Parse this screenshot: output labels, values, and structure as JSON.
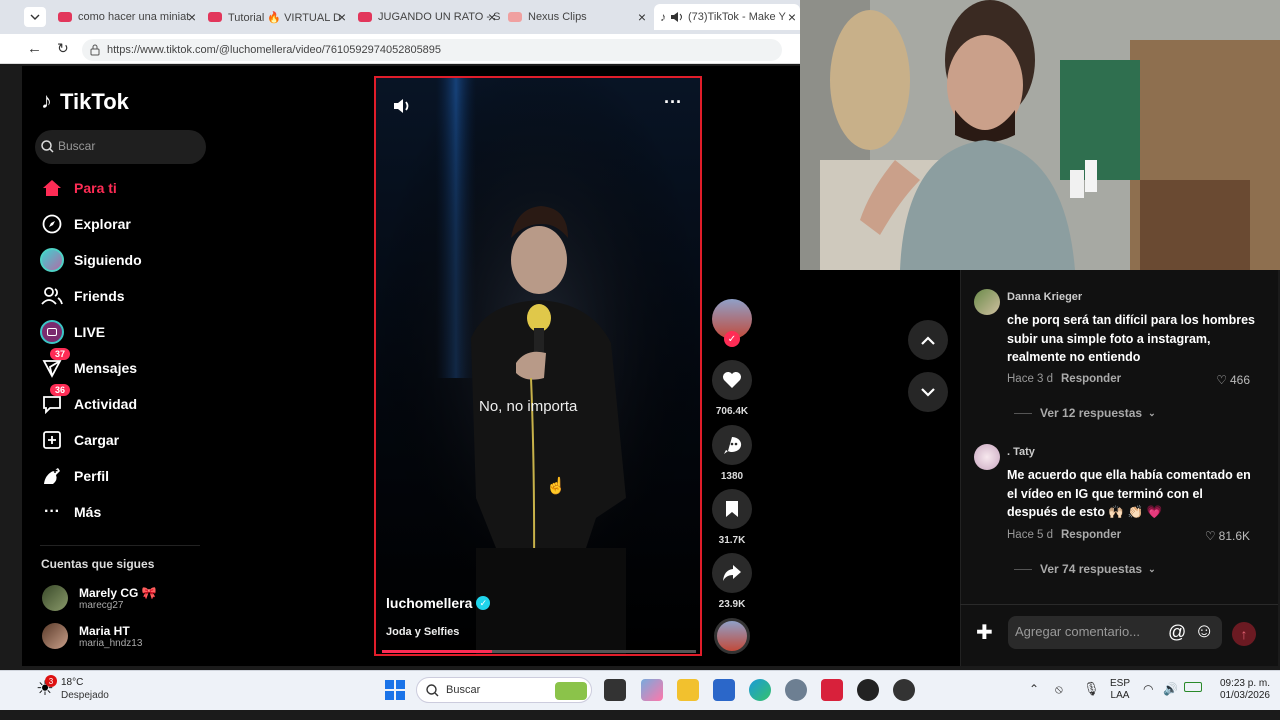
{
  "browser": {
    "tabs": [
      {
        "title": "como hacer una miniat",
        "color": "#e24a7c"
      },
      {
        "title": "Tutorial 🔥 VIRTUAL D",
        "color": "#e24a7c"
      },
      {
        "title": "JUGANDO UN RATO - S",
        "color": "#e24a7c"
      },
      {
        "title": "Nexus Clips",
        "color": "#f08a8a"
      },
      {
        "title": "(73)TikTok - Make Y",
        "color": "#000000",
        "active": true
      }
    ],
    "url": "https://www.tiktok.com/@luchomellera/video/7610592974052805895"
  },
  "tiktok": {
    "logo": "TikTok",
    "search_placeholder": "Buscar",
    "nav": [
      {
        "label": "Para ti",
        "icon": "home-icon",
        "active": true
      },
      {
        "label": "Explorar",
        "icon": "compass-icon"
      },
      {
        "label": "Siguiendo",
        "icon": "following-icon"
      },
      {
        "label": "Friends",
        "icon": "friends-icon"
      },
      {
        "label": "LIVE",
        "icon": "live-icon"
      },
      {
        "label": "Mensajes",
        "icon": "messages-icon",
        "badge": "37"
      },
      {
        "label": "Actividad",
        "icon": "activity-icon",
        "badge": "36"
      },
      {
        "label": "Cargar",
        "icon": "upload-icon"
      },
      {
        "label": "Perfil",
        "icon": "profile-icon"
      },
      {
        "label": "Más",
        "icon": "more-icon"
      }
    ],
    "following_title": "Cuentas que sigues",
    "accounts": [
      {
        "name": "Marely CG 🎀",
        "handle": "marecg27"
      },
      {
        "name": "Maria HT",
        "handle": "maria_hndz13"
      }
    ],
    "video": {
      "caption": "No, no importa",
      "author": "luchomellera",
      "music": "Joda y Selfies",
      "progress": 0.35,
      "likes": "706.4K",
      "comments": "1380",
      "saves": "31.7K",
      "shares": "23.9K"
    },
    "comments": [
      {
        "user": "Danna Krieger",
        "text": "che porq será tan difícil para los hombres subir una simple foto a instagram, realmente no entiendo",
        "time": "Hace 3 d",
        "reply": "Responder",
        "likes": "466",
        "more": "Ver 12 respuestas"
      },
      {
        "user": ". Taty",
        "text": "Me acuerdo que ella había comentado en el vídeo en IG que terminó con el después de esto 🙌🏻 👏🏻 💗",
        "time": "Hace 5 d",
        "reply": "Responder",
        "likes": "81.6K",
        "more": "Ver 74 respuestas"
      }
    ],
    "comment_placeholder": "Agregar comentario..."
  },
  "taskbar": {
    "weather_temp": "18°C",
    "weather_desc": "Despejado",
    "weather_badge": "3",
    "search": "Buscar",
    "lang_top": "ESP",
    "lang_bottom": "LAA",
    "time": "09:23 p. m.",
    "date": "01/03/2026"
  }
}
